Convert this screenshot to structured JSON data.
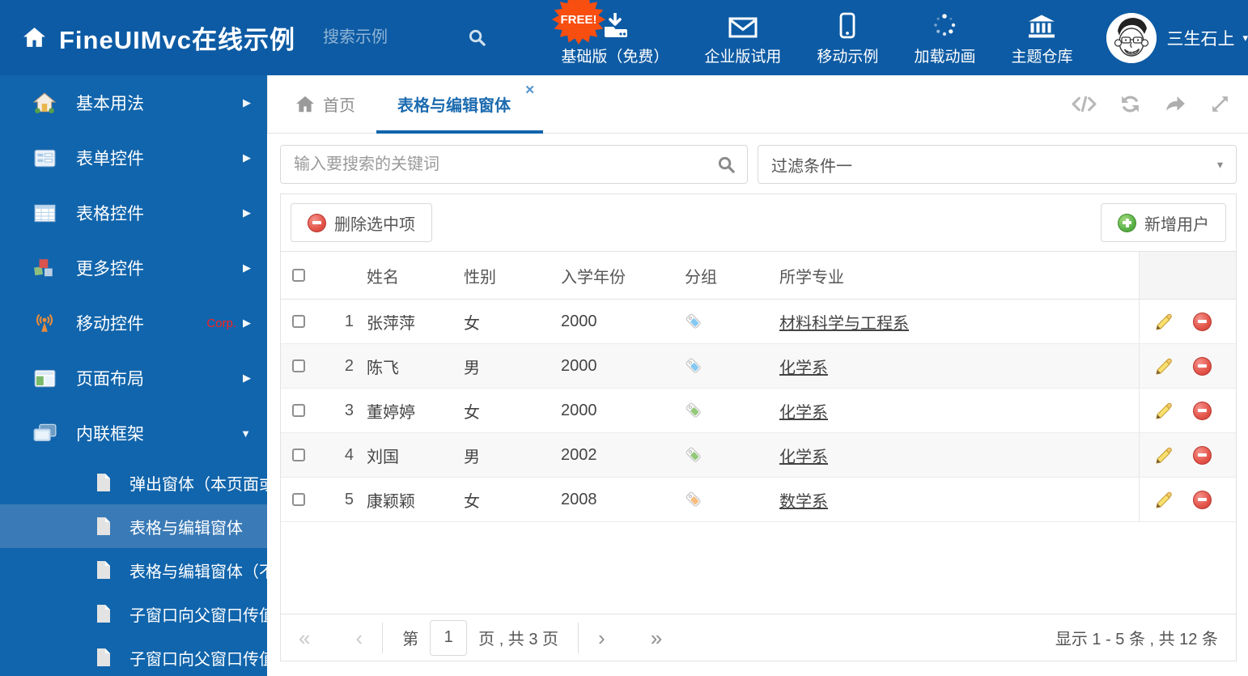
{
  "header": {
    "logo_title": "FineUIMvc在线示例",
    "search_placeholder": "搜索示例",
    "free_badge": "FREE!",
    "nav": [
      {
        "label": "基础版（免费）",
        "icon": "download-icon"
      },
      {
        "label": "企业版试用",
        "icon": "envelope-icon"
      },
      {
        "label": "移动示例",
        "icon": "mobile-icon"
      },
      {
        "label": "加载动画",
        "icon": "spinner-icon"
      },
      {
        "label": "主题仓库",
        "icon": "bank-icon"
      }
    ],
    "username": "三生石上"
  },
  "sidebar": {
    "items": [
      {
        "label": "基本用法",
        "icon": "home-colored-icon"
      },
      {
        "label": "表单控件",
        "icon": "form-icon"
      },
      {
        "label": "表格控件",
        "icon": "table-icon"
      },
      {
        "label": "更多控件",
        "icon": "cubes-icon"
      },
      {
        "label": "移动控件",
        "icon": "antenna-icon",
        "badge": "Corp."
      },
      {
        "label": "页面布局",
        "icon": "layout-icon"
      },
      {
        "label": "内联框架",
        "icon": "frames-icon",
        "expanded": true
      }
    ],
    "subitems": [
      {
        "label": "弹出窗体（本页面或..."
      },
      {
        "label": "表格与编辑窗体",
        "selected": true
      },
      {
        "label": "表格与编辑窗体（不..."
      },
      {
        "label": "子窗口向父窗口传值"
      },
      {
        "label": "子窗口向父窗口传值..."
      }
    ]
  },
  "tabs": [
    {
      "label": "首页",
      "icon": "home-gray-icon"
    },
    {
      "label": "表格与编辑窗体",
      "active": true
    }
  ],
  "tab_action_icons": [
    "code-icon",
    "refresh-icon",
    "share-icon",
    "fullscreen-icon"
  ],
  "content": {
    "keyword_placeholder": "输入要搜索的关键词",
    "filter_selected": "过滤条件一",
    "delete_button_label": "删除选中项",
    "add_button_label": "新增用户",
    "table": {
      "columns": [
        "姓名",
        "性别",
        "入学年份",
        "分组",
        "所学专业"
      ],
      "tag_colors": {
        "blue": "#85c8f2",
        "green": "#93c979",
        "orange": "#f7bd7f"
      },
      "rows": [
        {
          "index": "1",
          "name": "张萍萍",
          "gender": "女",
          "year": "2000",
          "tag": "blue",
          "major": "材料科学与工程系"
        },
        {
          "index": "2",
          "name": "陈飞",
          "gender": "男",
          "year": "2000",
          "tag": "blue",
          "major": "化学系"
        },
        {
          "index": "3",
          "name": "董婷婷",
          "gender": "女",
          "year": "2000",
          "tag": "green",
          "major": "化学系"
        },
        {
          "index": "4",
          "name": "刘国",
          "gender": "男",
          "year": "2002",
          "tag": "green",
          "major": "化学系"
        },
        {
          "index": "5",
          "name": "康颖颖",
          "gender": "女",
          "year": "2008",
          "tag": "orange",
          "major": "数学系"
        }
      ]
    },
    "pagination": {
      "first": "«",
      "prev": "‹",
      "next": "›",
      "last": "»",
      "page_prefix": "第",
      "page_value": "1",
      "page_suffix": "页 , 共 3 页",
      "summary": "显示 1 - 5 条 , 共 12 条"
    }
  },
  "colors": {
    "topbar": "#0d5ba4",
    "sidebar": "#1165ac",
    "sidebar_selected": "#3a7ab6",
    "tab_active": "#1c6bb0",
    "free_badge": "#f84e10",
    "delete_red": "#e3544a",
    "add_green": "#5cb348"
  }
}
